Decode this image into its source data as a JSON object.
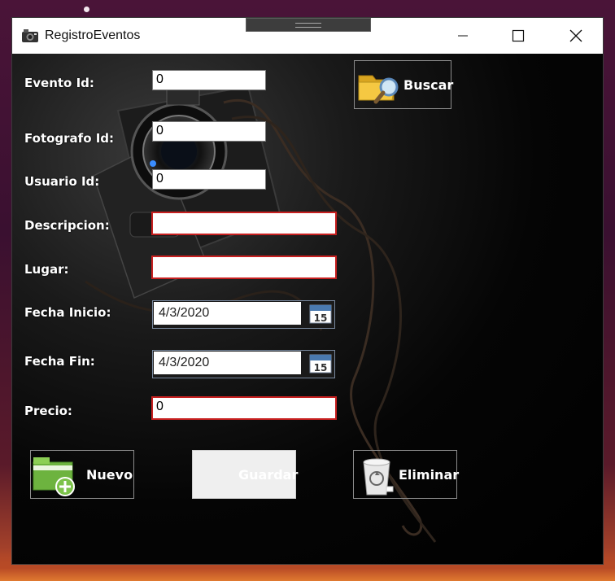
{
  "window": {
    "title": "RegistroEventos"
  },
  "form": {
    "evento_id": {
      "label": "Evento Id:",
      "value": "0"
    },
    "fotografo_id": {
      "label": "Fotografo Id:",
      "value": "0"
    },
    "usuario_id": {
      "label": "Usuario Id:",
      "value": "0"
    },
    "descripcion": {
      "label": "Descripcion:",
      "value": ""
    },
    "lugar": {
      "label": "Lugar:",
      "value": ""
    },
    "fecha_inicio": {
      "label": "Fecha Inicio:",
      "value": "4/3/2020",
      "calendar_day": "15"
    },
    "fecha_fin": {
      "label": "Fecha Fin:",
      "value": "4/3/2020",
      "calendar_day": "15"
    },
    "precio": {
      "label": "Precio:",
      "value": "0"
    }
  },
  "buttons": {
    "buscar": "Buscar",
    "nuevo": "Nuevo",
    "guardar": "Guardar",
    "eliminar": "Eliminar"
  },
  "colors": {
    "invalid_border": "#c82020",
    "window_bg": "#000000"
  },
  "icons": [
    "camera-icon",
    "minimize-icon",
    "maximize-icon",
    "close-icon",
    "folder-search-icon",
    "calendar-icon",
    "new-folder-icon",
    "recycle-bin-icon"
  ]
}
